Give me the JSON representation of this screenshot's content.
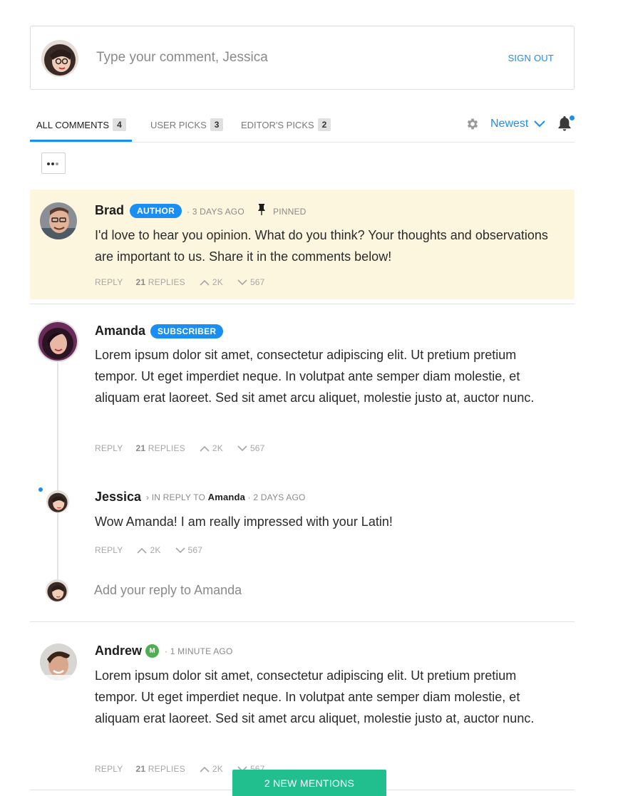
{
  "composer": {
    "placeholder": "Type your comment, Jessica",
    "sign_out": "SIGN OUT"
  },
  "tabs": [
    {
      "label": "ALL COMMENTS",
      "count": "4"
    },
    {
      "label": "USER PICKS",
      "count": "3"
    },
    {
      "label": "EDITOR'S PICKS",
      "count": "2"
    }
  ],
  "sort": {
    "label": "Newest"
  },
  "comments": {
    "brad": {
      "author": "Brad",
      "badge": "AUTHOR",
      "time": "· 3 DAYS AGO",
      "pinned": "PINNED",
      "body": "I'd love to hear you opinion. What do you think? Your thoughts and observations are important to us. Share it in the comments below!",
      "reply": "REPLY",
      "replies_count": "21",
      "replies_label": "REPLIES",
      "upvotes": "2K",
      "downvotes": "567"
    },
    "amanda": {
      "author": "Amanda",
      "badge": "SUBSCRIBER",
      "body": "Lorem ipsum dolor sit amet, consectetur adipiscing elit. Ut pretium pretium tempor. Ut eget imperdiet neque. In volutpat ante semper diam molestie, et aliquam erat laoreet. Sed sit amet arcu aliquet, molestie justo at, auctor nunc.",
      "reply": "REPLY",
      "replies_count": "21",
      "replies_label": "REPLIES",
      "upvotes": "2K",
      "downvotes": "567"
    },
    "jessica": {
      "author": "Jessica",
      "in_reply_to": "› IN REPLY TO",
      "reply_target": "Amanda",
      "time": "· 2 DAYS AGO",
      "body": "Wow Amanda! I am really impressed with your Latin!",
      "reply": "REPLY",
      "upvotes": "2K",
      "downvotes": "567"
    },
    "reply_box": {
      "placeholder": "Add your reply to Amanda"
    },
    "andrew": {
      "author": "Andrew",
      "mod_badge": "M",
      "time": "· 1 MINUTE AGO",
      "body": "Lorem ipsum dolor sit amet, consectetur adipiscing elit. Ut pretium pretium tempor. Ut eget imperdiet neque. In volutpat ante semper diam molestie, et aliquam erat laoreet. Sed sit amet arcu aliquet, molestie justo at, auctor nunc.",
      "reply": "REPLY",
      "replies_count": "21",
      "replies_label": "REPLIES",
      "upvotes": "2K",
      "downvotes": "567"
    }
  },
  "new_mentions": "2 NEW MENTIONS",
  "colors": {
    "accent": "#1a8ef2",
    "pinned_bg": "#fdf6de",
    "mentions_bg": "#22bf8e",
    "moderator": "#4cb050"
  }
}
